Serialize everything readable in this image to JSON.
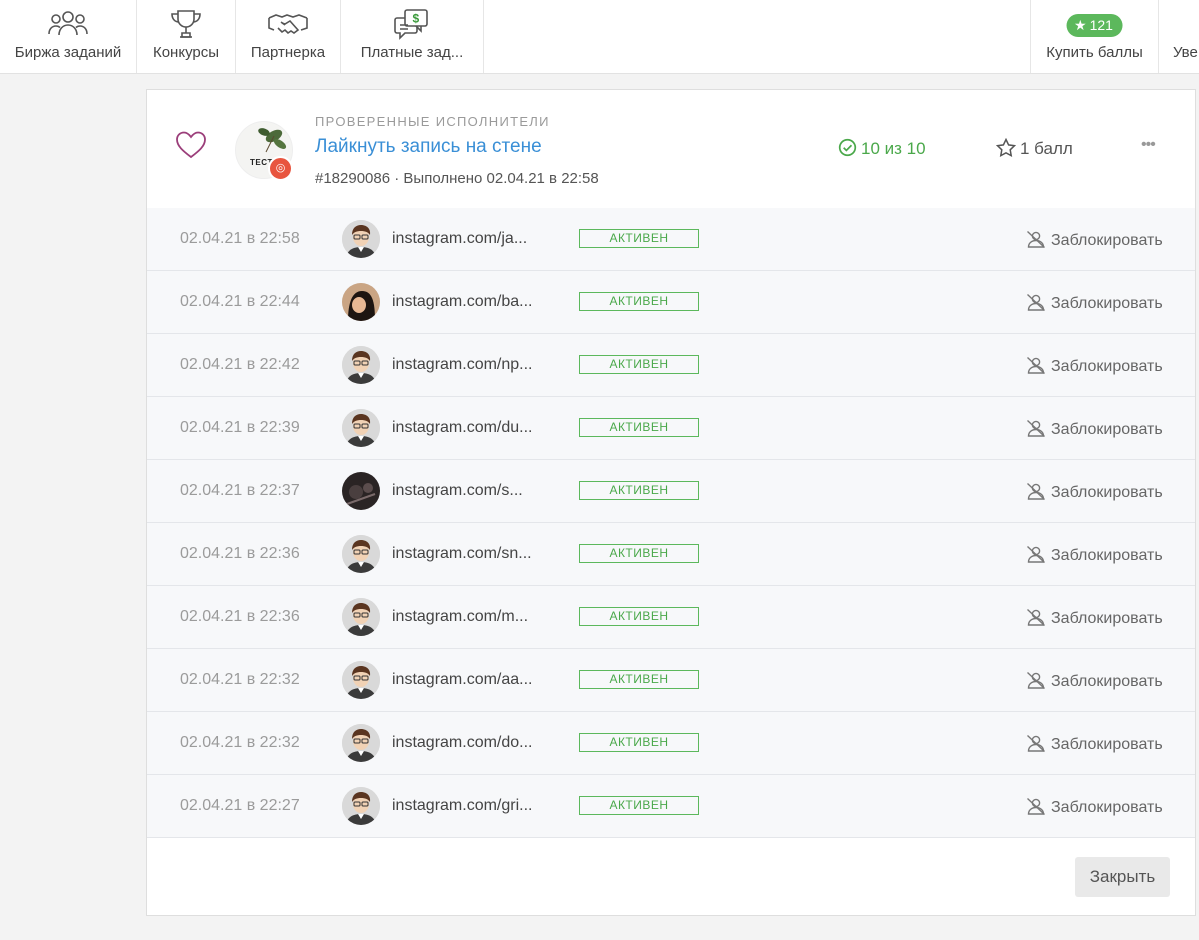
{
  "nav": {
    "items": [
      {
        "label": "Биржа заданий",
        "icon": "users-icon"
      },
      {
        "label": "Конкурсы",
        "icon": "trophy-icon"
      },
      {
        "label": "Партнерка",
        "icon": "handshake-icon"
      },
      {
        "label": "Платные зад...",
        "icon": "paid-chat-icon"
      }
    ],
    "points": "121",
    "buy_label": "Купить баллы",
    "notify_label": "Уве"
  },
  "task": {
    "category": "Проверенные исполнители",
    "title": "Лайкнуть запись на стене",
    "meta": "#18290086 · Выполнено 02.04.21 в 22:58",
    "progress": "10 из 10",
    "reward": "1 балл",
    "avatar_text": "TECT",
    "more": "•••"
  },
  "executors": [
    {
      "time": "02.04.21 в 22:58",
      "link": "instagram.com/ja...",
      "status": "АКТИВЕН",
      "action": "Заблокировать",
      "avatar": "default"
    },
    {
      "time": "02.04.21 в 22:44",
      "link": "instagram.com/ba...",
      "status": "АКТИВЕН",
      "action": "Заблокировать",
      "avatar": "photo-girl"
    },
    {
      "time": "02.04.21 в 22:42",
      "link": "instagram.com/np...",
      "status": "АКТИВЕН",
      "action": "Заблокировать",
      "avatar": "default"
    },
    {
      "time": "02.04.21 в 22:39",
      "link": "instagram.com/du...",
      "status": "АКТИВЕН",
      "action": "Заблокировать",
      "avatar": "default"
    },
    {
      "time": "02.04.21 в 22:37",
      "link": "instagram.com/s...",
      "status": "АКТИВЕН",
      "action": "Заблокировать",
      "avatar": "photo-dark"
    },
    {
      "time": "02.04.21 в 22:36",
      "link": "instagram.com/sn...",
      "status": "АКТИВЕН",
      "action": "Заблокировать",
      "avatar": "default"
    },
    {
      "time": "02.04.21 в 22:36",
      "link": "instagram.com/m...",
      "status": "АКТИВЕН",
      "action": "Заблокировать",
      "avatar": "default"
    },
    {
      "time": "02.04.21 в 22:32",
      "link": "instagram.com/aa...",
      "status": "АКТИВЕН",
      "action": "Заблокировать",
      "avatar": "default"
    },
    {
      "time": "02.04.21 в 22:32",
      "link": "instagram.com/do...",
      "status": "АКТИВЕН",
      "action": "Заблокировать",
      "avatar": "default"
    },
    {
      "time": "02.04.21 в 22:27",
      "link": "instagram.com/gri...",
      "status": "АКТИВЕН",
      "action": "Заблокировать",
      "avatar": "default"
    }
  ],
  "footer": {
    "close_label": "Закрыть"
  },
  "colors": {
    "accent_green": "#5cb85c",
    "link_blue": "#3a8fd6",
    "heart": "#9b3e7a",
    "instagram_badge": "#e8553f"
  }
}
